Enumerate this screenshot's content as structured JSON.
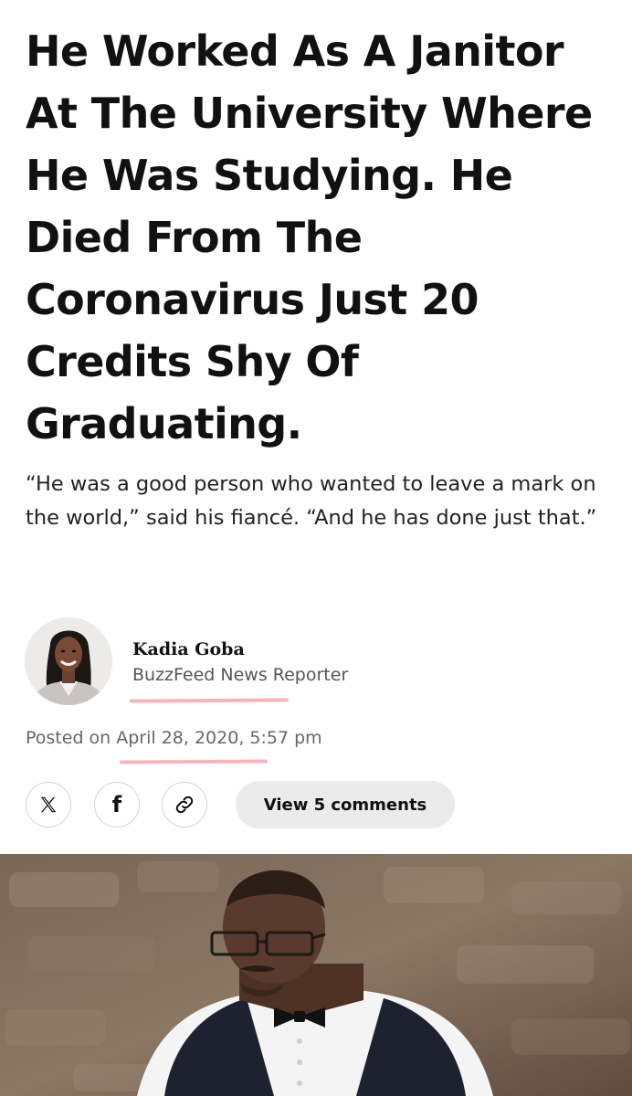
{
  "article": {
    "headline": "He Worked As A Janitor At The University Where He Was Studying. He Died From The Coronavirus Just 20 Credits Shy Of Graduating.",
    "dek": "“He was a good person who wanted to leave a mark on the world,” said his fiancé. “And he has done just that.”"
  },
  "byline": {
    "author_name": "Kadia Goba",
    "author_role": "BuzzFeed News Reporter",
    "posted_label": "Posted on ",
    "posted_date": "April 28, 2020, 5:57 pm"
  },
  "share": {
    "icons": [
      "x-logo-icon",
      "facebook-icon",
      "link-icon"
    ],
    "comments_label": "View 5 comments"
  },
  "colors": {
    "highlight_underline": "#f4b6ba",
    "comments_button_bg": "#ebebeb",
    "text_primary": "#111111",
    "text_secondary": "#555555"
  }
}
